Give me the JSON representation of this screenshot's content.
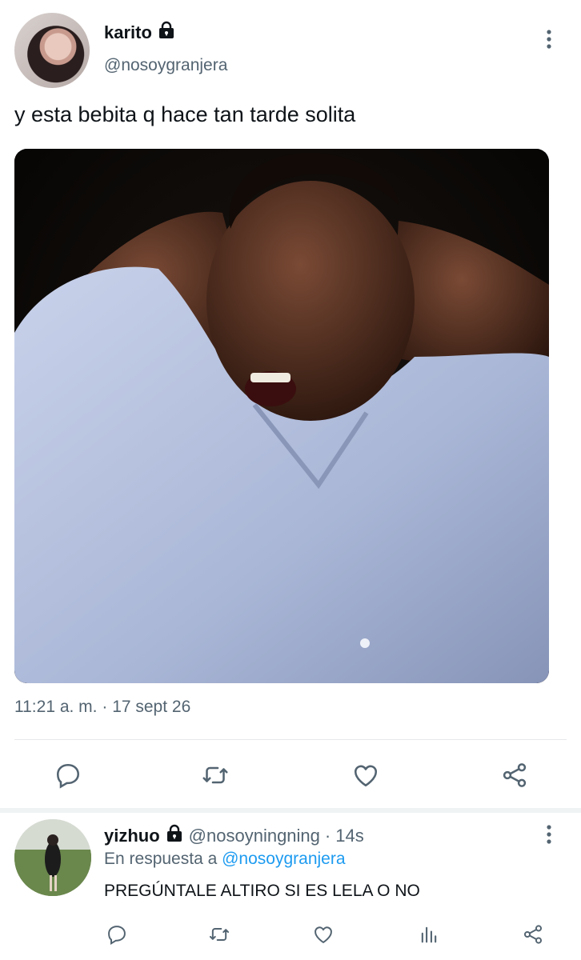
{
  "tweet": {
    "display_name": "karito",
    "handle": "@nosoygranjera",
    "text": "y esta bebita q hace tan tarde solita",
    "time": "11:21 a. m.",
    "separator": " · ",
    "date": "17 sept 26",
    "more_icon": "more-vertical-icon",
    "lock_icon": "lock-icon",
    "actions": [
      "reply-icon",
      "retweet-icon",
      "like-icon",
      "share-icon"
    ]
  },
  "reply": {
    "display_name": "yizhuo",
    "handle": "@nosoyningning",
    "age_sep": "·",
    "age": "14s",
    "in_reply_prefix": "En respuesta a",
    "in_reply_handle": "@nosoygranjera",
    "text": "PREGÚNTALE ALTIRO SI ES LELA O NO",
    "actions": [
      "reply-icon",
      "retweet-icon",
      "like-icon",
      "analytics-icon",
      "share-icon"
    ]
  },
  "colors": {
    "text": "#0f1419",
    "secondary": "#536471",
    "link": "#1d9bf0",
    "divider": "#e6e8ea"
  }
}
